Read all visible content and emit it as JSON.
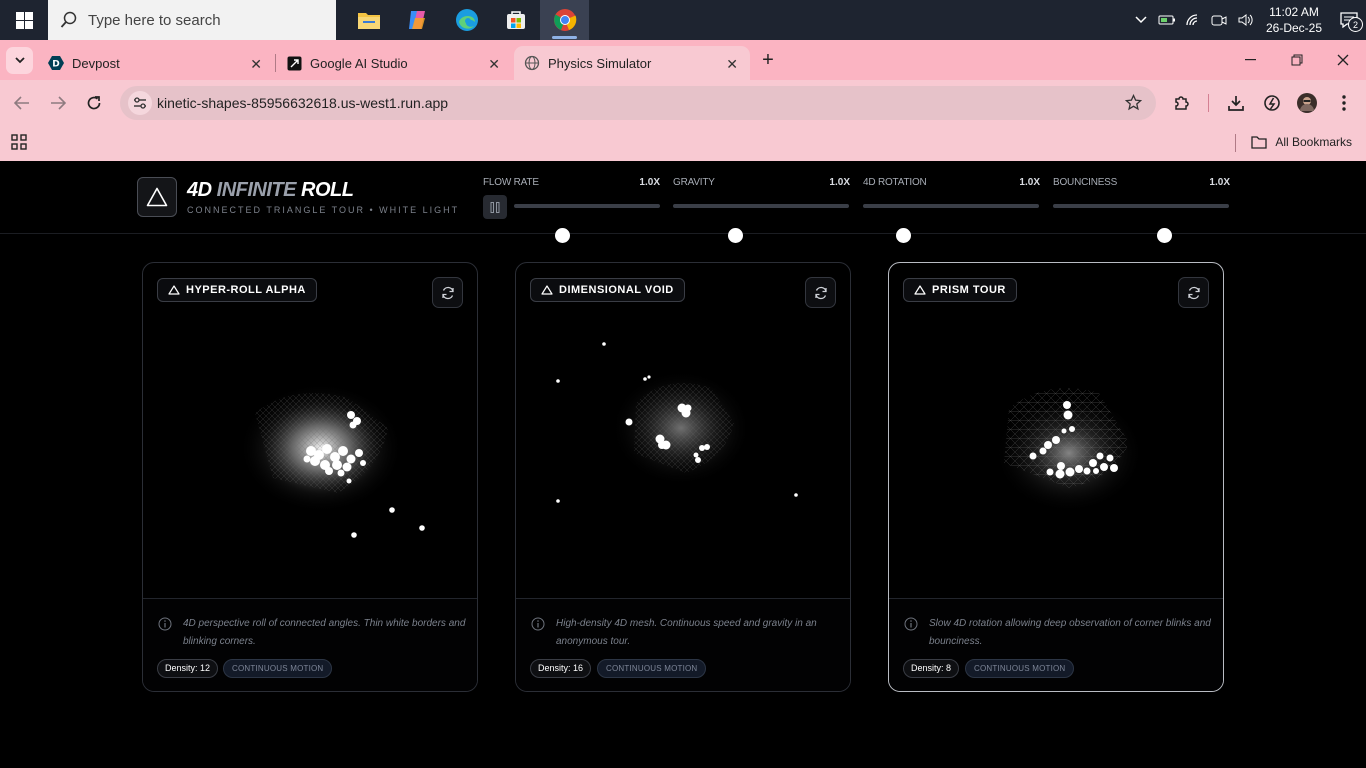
{
  "taskbar": {
    "search_placeholder": "Type here to search",
    "time": "11:02 AM",
    "date": "26-Dec-25",
    "notification_count": "2"
  },
  "browser": {
    "tabs": [
      {
        "title": "Devpost"
      },
      {
        "title": "Google AI Studio"
      },
      {
        "title": "Physics Simulator"
      }
    ],
    "url": "kinetic-shapes-85956632618.us-west1.run.app",
    "bookmarks_label": "All Bookmarks"
  },
  "app": {
    "brand_lead": "4D",
    "brand_mid": "INFINITE",
    "brand_tail": "ROLL",
    "subtitle": "CONNECTED TRIANGLE TOUR • WHITE LIGHT",
    "controls": [
      {
        "label": "FLOW RATE",
        "value": "1.0X",
        "level": 0.33
      },
      {
        "label": "GRAVITY",
        "value": "1.0X",
        "level": 0.35
      },
      {
        "label": "4D ROTATION",
        "value": "1.0X",
        "level": 0.23
      },
      {
        "label": "BOUNCINESS",
        "value": "1.0X",
        "level": 0.63
      }
    ],
    "cards": [
      {
        "title": "HYPER-ROLL ALPHA",
        "description": "4D perspective roll of connected angles. Thin white borders and blinking corners.",
        "density": "Density: 12",
        "mode": "CONTINUOUS MOTION"
      },
      {
        "title": "DIMENSIONAL VOID",
        "description": "High-density 4D mesh. Continuous speed and gravity in an anonymous tour.",
        "density": "Density: 16",
        "mode": "CONTINUOUS MOTION"
      },
      {
        "title": "PRISM TOUR",
        "description": "Slow 4D rotation allowing deep observation of corner blinks and bounciness.",
        "density": "Density: 8",
        "mode": "CONTINUOUS MOTION"
      }
    ]
  },
  "colors": {
    "accent": "#ffffff",
    "panel_border": "#2b2e36",
    "tab_strip": "#fbb4c2",
    "toolbar": "#f8c9d2"
  }
}
